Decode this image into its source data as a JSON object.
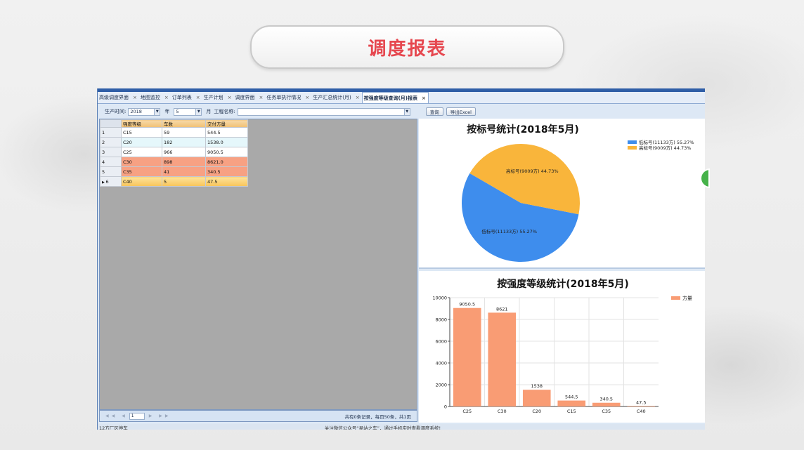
{
  "slide": {
    "title": "调度报表"
  },
  "tabs": [
    {
      "label": "高级调度界面",
      "active": false
    },
    {
      "label": "地图监控",
      "active": false
    },
    {
      "label": "订单列表",
      "active": false
    },
    {
      "label": "生产计划",
      "active": false
    },
    {
      "label": "调度界面",
      "active": false
    },
    {
      "label": "任务单执行情况",
      "active": false
    },
    {
      "label": "生产汇总统计(月)",
      "active": false
    },
    {
      "label": "按强度等级查询(月)报表",
      "active": true
    }
  ],
  "tab_close_glyph": "×",
  "toolbar": {
    "time_label": "生产时间:",
    "year_value": "2018",
    "year_label": "年",
    "month_value": "5",
    "month_label": "月",
    "project_label": "工程名称:",
    "project_value": "",
    "query_button": "查询",
    "export_button": "导出Excel"
  },
  "grid": {
    "columns": [
      "强度等级",
      "车数",
      "交付方量"
    ],
    "rows": [
      {
        "index": "1",
        "grade": "C15",
        "trucks": "59",
        "volume": "544.5",
        "style": "row-a"
      },
      {
        "index": "2",
        "grade": "C20",
        "trucks": "182",
        "volume": "1538.0",
        "style": "row-b"
      },
      {
        "index": "3",
        "grade": "C25",
        "trucks": "966",
        "volume": "9050.5",
        "style": "row-a"
      },
      {
        "index": "4",
        "grade": "C30",
        "trucks": "898",
        "volume": "8621.0",
        "style": "row-hot"
      },
      {
        "index": "5",
        "grade": "C35",
        "trucks": "41",
        "volume": "340.5",
        "style": "row-hot"
      },
      {
        "index": "6",
        "grade": "C40",
        "trucks": "5",
        "volume": "47.5",
        "style": "row-sel"
      }
    ]
  },
  "pager": {
    "page_value": "1",
    "info": "共有0条记录，每页50条，共1页"
  },
  "status": {
    "left": "12方厂区停车",
    "center": "关注微信公众号“易站之车”，通过手机实时查看调度系统!"
  },
  "chart_data": [
    {
      "type": "pie",
      "title": "按标号统计(2018年5月)",
      "slices": [
        {
          "label": "低标号(11133方) 55.27%",
          "value": 55.27,
          "color": "#3e8ded"
        },
        {
          "label": "高标号(9009方) 44.73%",
          "value": 44.73,
          "color": "#f9b53b"
        }
      ],
      "legend": "top-right"
    },
    {
      "type": "bar",
      "title": "按强度等级统计(2018年5月)",
      "categories": [
        "C25",
        "C30",
        "C20",
        "C15",
        "C35",
        "C40"
      ],
      "values": [
        9050.5,
        8621,
        1538,
        544.5,
        340.5,
        47.5
      ],
      "data_labels": [
        "9050.5",
        "8621",
        "1538",
        "544.5",
        "340.5",
        "47.5"
      ],
      "series_name": "方量",
      "ylim": [
        0,
        10000
      ],
      "yticks": [
        0,
        2000,
        4000,
        6000,
        8000,
        10000
      ],
      "grid": true,
      "legend": "top-right",
      "color": "#f99c74"
    }
  ]
}
